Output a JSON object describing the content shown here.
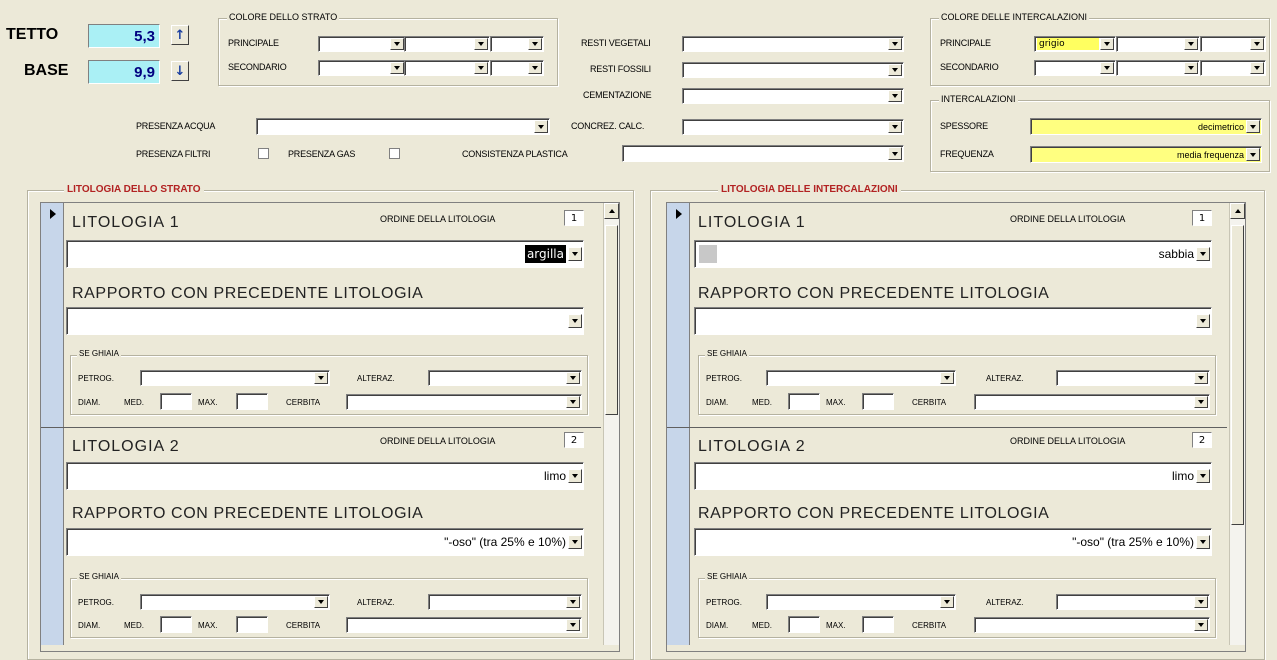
{
  "tetto": {
    "label": "TETTO",
    "value": "5,3",
    "button_icon": "arrow-up-icon"
  },
  "base": {
    "label": "BASE",
    "value": "9,9",
    "button_icon": "arrow-down-icon"
  },
  "colore_strato": {
    "title": "COLORE DELLO STRATO",
    "principale": "PRINCIPALE",
    "secondario": "SECONDARIO"
  },
  "resti": {
    "vegetali": "RESTI VEGETALI",
    "fossili": "RESTI FOSSILI",
    "cementazione": "CEMENTAZIONE",
    "concrez": "CONCREZ. CALC."
  },
  "presenza": {
    "acqua": "PRESENZA ACQUA",
    "filtri": "PRESENZA FILTRI",
    "gas": "PRESENZA GAS",
    "consistenza": "CONSISTENZA PLASTICA"
  },
  "colore_interc": {
    "title": "COLORE DELLE INTERCALAZIONI",
    "principale": "PRINCIPALE",
    "principale_value": "grigio",
    "secondario": "SECONDARIO"
  },
  "intercalazioni": {
    "title": "INTERCALAZIONI",
    "spessore": "SPESSORE",
    "spessore_value": "decimetrico",
    "frequenza": "FREQUENZA",
    "frequenza_value": "media frequenza"
  },
  "left_panel": {
    "title": "LITOLOGIA DELLO STRATO",
    "records": [
      {
        "heading": "LITOLOGIA  1",
        "ord_label": "ORDINE DELLA LITOLOGIA",
        "ord": "1",
        "lito": "argilla",
        "rap_label": "RAPPORTO CON PRECEDENTE LITOLOGIA",
        "rap": ""
      },
      {
        "heading": "LITOLOGIA  2",
        "ord_label": "ORDINE DELLA LITOLOGIA",
        "ord": "2",
        "lito": "limo",
        "rap_label": "RAPPORTO CON PRECEDENTE LITOLOGIA",
        "rap": "\"-oso\" (tra 25% e 10%)"
      }
    ]
  },
  "right_panel": {
    "title": "LITOLOGIA DELLE INTERCALAZIONI",
    "records": [
      {
        "heading": "LITOLOGIA  1",
        "ord_label": "ORDINE DELLA LITOLOGIA",
        "ord": "1",
        "lito": "sabbia",
        "rap_label": "RAPPORTO CON PRECEDENTE LITOLOGIA",
        "rap": ""
      },
      {
        "heading": "LITOLOGIA  2",
        "ord_label": "ORDINE DELLA LITOLOGIA",
        "ord": "2",
        "lito": "limo",
        "rap_label": "RAPPORTO CON PRECEDENTE LITOLOGIA",
        "rap": "\"-oso\" (tra 25% e 10%)"
      }
    ]
  },
  "ghiaia": {
    "title": "SE GHIAIA",
    "petrog": "PETROG.",
    "alteraz": "ALTERAZ.",
    "diam": "DIAM.",
    "med": "MED.",
    "max": "MAX.",
    "cerbita": "CERBITA"
  }
}
